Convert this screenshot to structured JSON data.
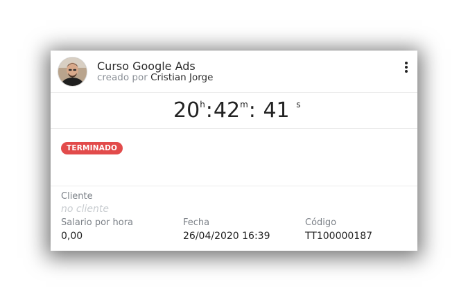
{
  "card": {
    "title": "Curso Google Ads",
    "created_by_prefix": "creado por",
    "author": "Cristian Jorge",
    "timer": {
      "hours": "20",
      "hours_unit": "h",
      "minutes": "42",
      "minutes_unit": "m",
      "seconds": "41",
      "seconds_unit": "s"
    },
    "status": "TERMINADO",
    "client_label": "Cliente",
    "client_value": "no cliente",
    "rate_label": "Salario por hora",
    "rate_value": "0,00",
    "date_label": "Fecha",
    "date_value": "26/04/2020 16:39",
    "code_label": "Código",
    "code_value": "TT100000187"
  },
  "colors": {
    "status_badge": "#e24b4b",
    "muted_text": "#8a8f96",
    "placeholder_text": "#c8ccd0"
  },
  "icons": {
    "menu": "more-vertical-icon",
    "avatar": "user-photo"
  }
}
